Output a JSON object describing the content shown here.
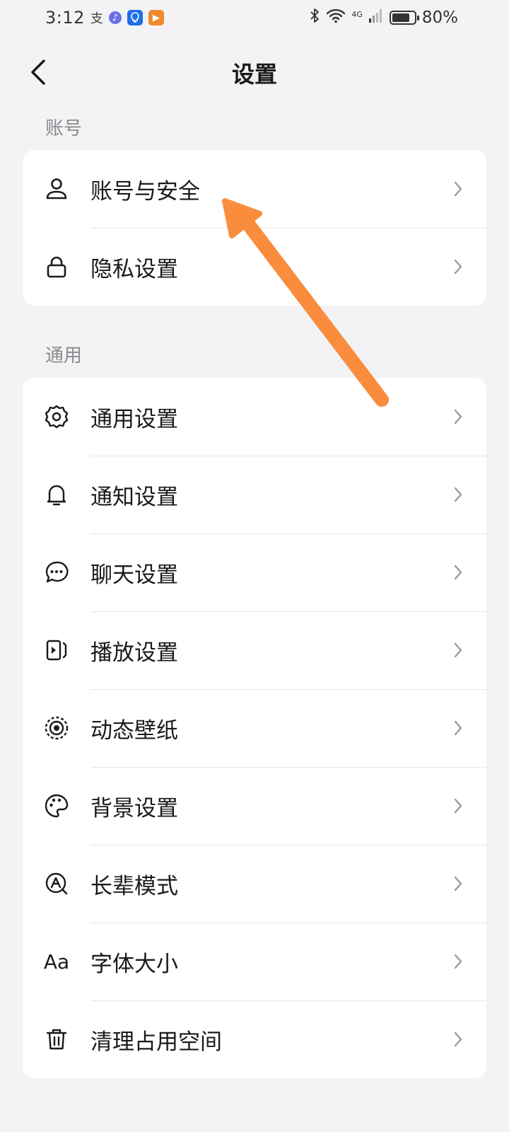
{
  "status_bar": {
    "time": "3:12",
    "notif_text": "支",
    "network_type": "4G",
    "battery_level": 0.8,
    "battery_text": "80%"
  },
  "header": {
    "title": "设置"
  },
  "sections": {
    "account": {
      "label": "账号",
      "items": [
        {
          "label": "账号与安全",
          "icon": "user-icon"
        },
        {
          "label": "隐私设置",
          "icon": "lock-icon"
        }
      ]
    },
    "general": {
      "label": "通用",
      "items": [
        {
          "label": "通用设置",
          "icon": "gear-icon"
        },
        {
          "label": "通知设置",
          "icon": "bell-icon"
        },
        {
          "label": "聊天设置",
          "icon": "chat-bubble-icon"
        },
        {
          "label": "播放设置",
          "icon": "playback-icon"
        },
        {
          "label": "动态壁纸",
          "icon": "live-wallpaper-icon"
        },
        {
          "label": "背景设置",
          "icon": "palette-icon"
        },
        {
          "label": "长辈模式",
          "icon": "elder-mode-icon"
        },
        {
          "label": "字体大小",
          "icon": "font-size-icon",
          "icon_text": "Aa"
        },
        {
          "label": "清理占用空间",
          "icon": "trash-icon"
        }
      ]
    }
  },
  "colors": {
    "background": "#f3f3f5",
    "card": "#ffffff",
    "text": "#1a1a1a",
    "secondary_text": "#8a8a8e",
    "chevron": "#9a9a9e",
    "annotation_arrow": "#f98d3d"
  }
}
